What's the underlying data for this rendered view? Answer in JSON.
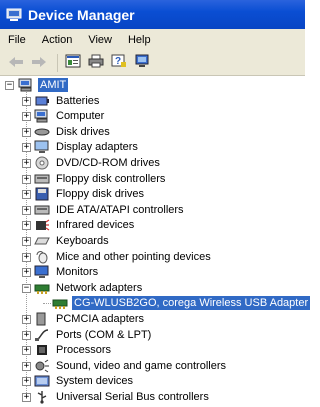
{
  "window": {
    "title": "Device Manager"
  },
  "menu": [
    "File",
    "Action",
    "View",
    "Help"
  ],
  "toolbar": {
    "buttons": [
      "back-icon",
      "forward-icon",
      "properties-icon",
      "print-icon",
      "help-icon",
      "scan-icon"
    ]
  },
  "tree": {
    "root": "AMIT",
    "items": [
      {
        "label": "Batteries",
        "icon": "battery-icon"
      },
      {
        "label": "Computer",
        "icon": "computer-icon"
      },
      {
        "label": "Disk drives",
        "icon": "disk-drive-icon"
      },
      {
        "label": "Display adapters",
        "icon": "display-icon"
      },
      {
        "label": "DVD/CD-ROM drives",
        "icon": "cdrom-icon"
      },
      {
        "label": "Floppy disk controllers",
        "icon": "controller-icon"
      },
      {
        "label": "Floppy disk drives",
        "icon": "floppy-icon"
      },
      {
        "label": "IDE ATA/ATAPI controllers",
        "icon": "controller-icon"
      },
      {
        "label": "Infrared devices",
        "icon": "infrared-icon"
      },
      {
        "label": "Keyboards",
        "icon": "keyboard-icon"
      },
      {
        "label": "Mice and other pointing devices",
        "icon": "mouse-icon"
      },
      {
        "label": "Monitors",
        "icon": "monitor-icon"
      },
      {
        "label": "Network adapters",
        "icon": "network-icon",
        "expanded": true,
        "child": "CG-WLUSB2GO, corega Wireless USB Adapter"
      },
      {
        "label": "PCMCIA adapters",
        "icon": "pcmcia-icon"
      },
      {
        "label": "Ports (COM & LPT)",
        "icon": "port-icon"
      },
      {
        "label": "Processors",
        "icon": "processor-icon"
      },
      {
        "label": "Sound, video and game controllers",
        "icon": "sound-icon"
      },
      {
        "label": "System devices",
        "icon": "system-icon"
      },
      {
        "label": "Universal Serial Bus controllers",
        "icon": "usb-icon"
      }
    ]
  },
  "colors": {
    "titlebar": "#0a4ed3",
    "selection": "#316ac5",
    "chrome": "#ece9d8"
  }
}
